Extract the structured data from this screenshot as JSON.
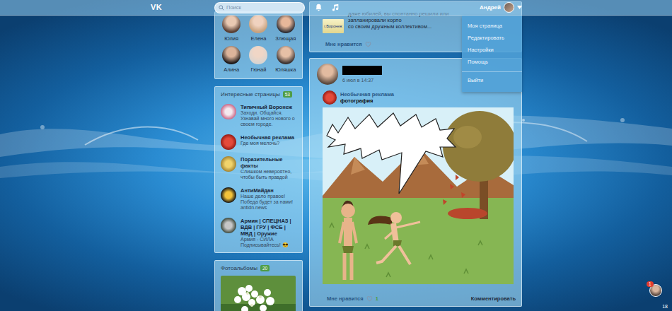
{
  "header": {
    "logo": "VK",
    "search": {
      "placeholder": "Поиск"
    },
    "user": {
      "name": "Андрей",
      "menu_open": true
    }
  },
  "user_menu": [
    {
      "label": "Моя страница",
      "divider_before": false
    },
    {
      "label": "Редактировать",
      "divider_before": false
    },
    {
      "label": "Настройки",
      "divider_before": false
    },
    {
      "label": "Помощь",
      "divider_before": false
    },
    {
      "label": "Выйти",
      "divider_before": true
    }
  ],
  "friends": [
    {
      "name": "Юлия"
    },
    {
      "name": "Елена"
    },
    {
      "name": "Злющая"
    },
    {
      "name": "Алина"
    },
    {
      "name": "Гюнай"
    },
    {
      "name": "Юляшка"
    }
  ],
  "pages": {
    "title": "Интересные страницы",
    "count": "53",
    "items": [
      {
        "name": "Типичный Воронеж",
        "status": "Заходи. Общайся. Узнавай много нового о своем городе."
      },
      {
        "name": "Необычная реклама",
        "status": "Где моя мелочь?"
      },
      {
        "name": "Поразительные факты",
        "status": "Слишком невероятно, чтобы быть правдой"
      },
      {
        "name": "АнтиМайдан",
        "status": "Наше дело правое! Победа будет за нами! antidn.news"
      },
      {
        "name": "Армия | СПЕЦНАЗ | ВДВ | ГРУ | ФСБ | МВД | Оружие",
        "status": "Армия - СИЛА Подписывайтесь! 😎"
      }
    ]
  },
  "albums": {
    "title": "Фотоальбомы",
    "count": "20"
  },
  "posts": [
    {
      "kind": "text",
      "tag": "г.Воронеж",
      "lines": [
        "даже юбилей, вы спонтанно решили или запланировали корпо",
        "со своим дружным коллективом..."
      ],
      "like_label": "Мне нравится",
      "liked": false
    },
    {
      "kind": "repost",
      "author_redacted": true,
      "date": "6 июл в 14:37",
      "repost": {
        "source": "Необычная реклама",
        "type": "фотография"
      },
      "like_label": "Мне нравится",
      "likes": "1",
      "liked": false,
      "comment_label": "Комментировать"
    }
  ],
  "notification": {
    "count": "1",
    "extra": "18"
  }
}
